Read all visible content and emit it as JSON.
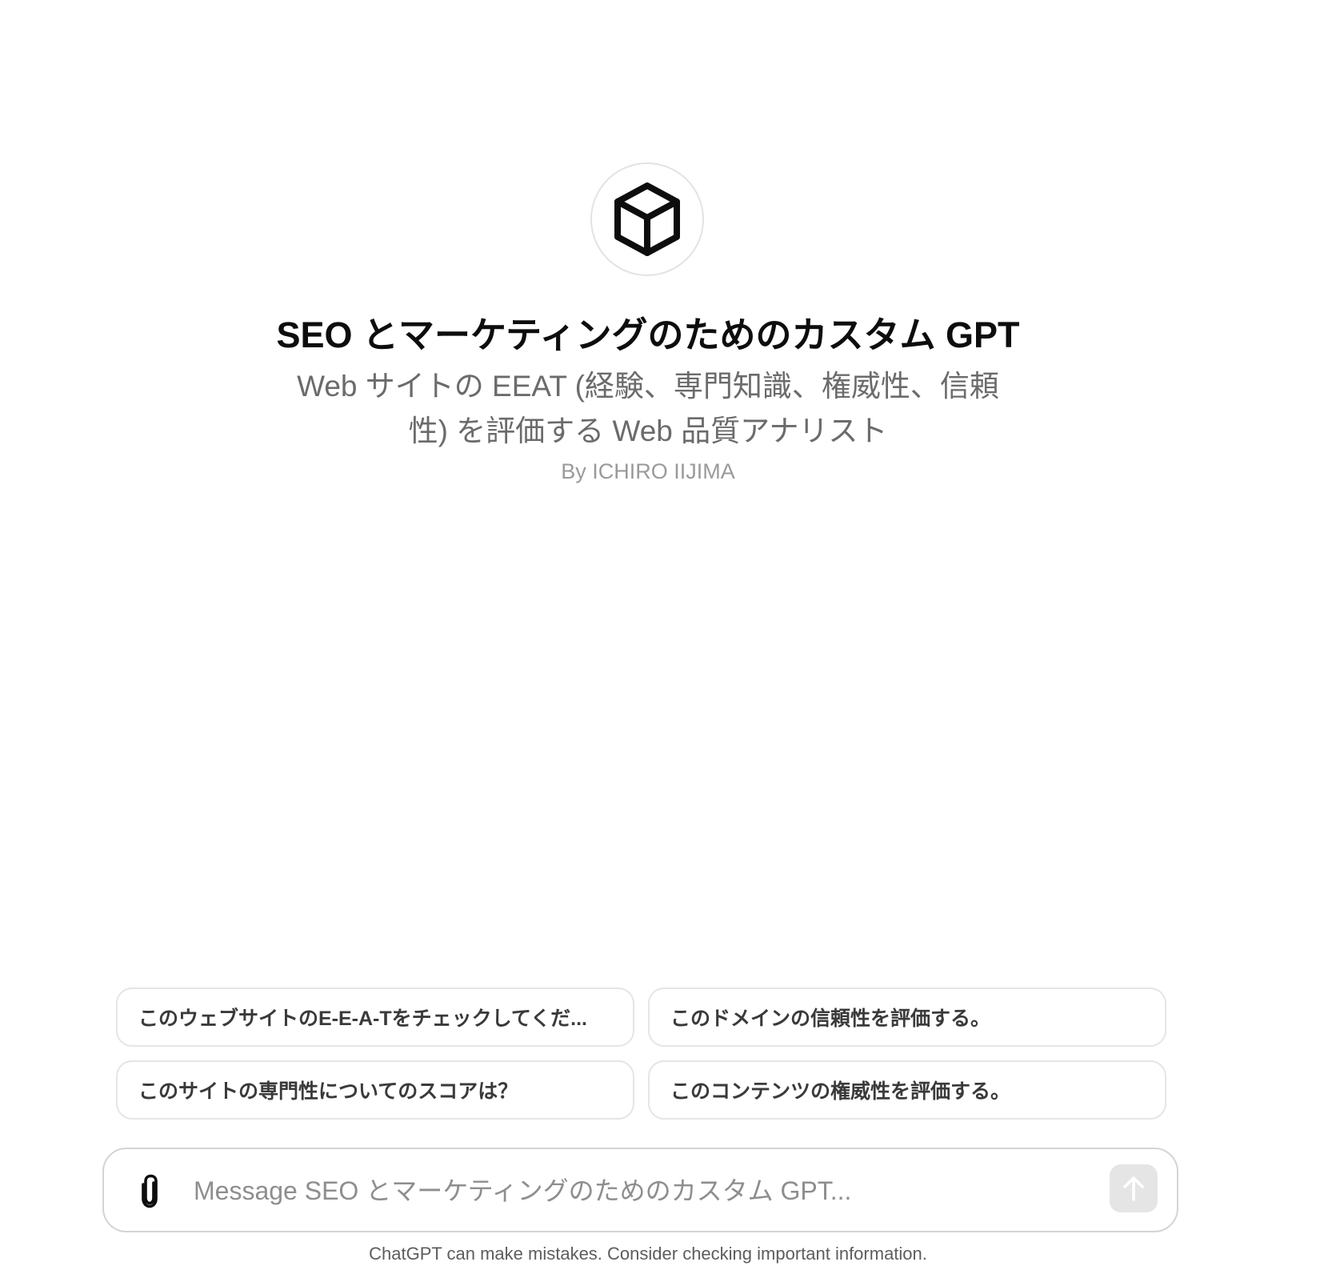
{
  "gpt": {
    "title": "SEO とマーケティングのためのカスタム GPT",
    "description": "Web サイトの EEAT (経験、専門知識、権威性、信頼性) を評価する Web 品質アナリスト",
    "author": "By ICHIRO IIJIMA",
    "avatar_icon": "cube-icon"
  },
  "starters": [
    {
      "label": "このウェブサイトのE-E-A-Tをチェックしてくだ..."
    },
    {
      "label": "このドメインの信頼性を評価する。"
    },
    {
      "label": "このサイトの専門性についてのスコアは？"
    },
    {
      "label": "このコンテンツの権威性を評価する。"
    }
  ],
  "composer": {
    "placeholder": "Message SEO とマーケティングのためのカスタム GPT...",
    "value": "",
    "attach_icon": "paperclip-icon",
    "send_icon": "arrow-up-icon"
  },
  "footer": {
    "note": "ChatGPT can make mistakes. Consider checking important information."
  }
}
